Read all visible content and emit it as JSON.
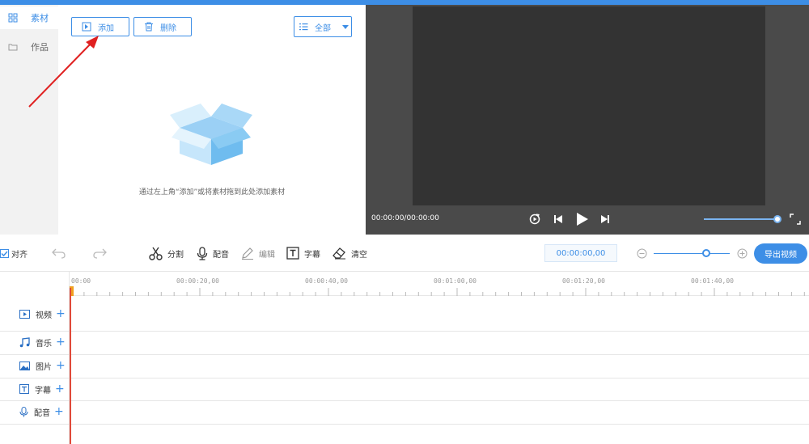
{
  "nav": {
    "items": [
      {
        "label": "素材",
        "icon": "grid-icon",
        "active": true
      },
      {
        "label": "作品",
        "icon": "folder-icon",
        "active": false
      }
    ]
  },
  "media": {
    "add_label": "添加",
    "delete_label": "删除",
    "filter_label": "全部",
    "empty_hint": "通过左上角“添加”或将素材拖到此处添加素材"
  },
  "preview": {
    "timecode": "00:00:00/00:00:00",
    "volume_level": 1.0
  },
  "toolbar": {
    "align_label": "对齐",
    "align_checked": true,
    "split_label": "分割",
    "dub_label": "配音",
    "edit_label": "编辑",
    "subtitle_label": "字幕",
    "clear_label": "清空",
    "time_value": "00:00:00,00",
    "zoom_level": 0.64,
    "export_label": "导出视频"
  },
  "timeline": {
    "ruler_labels": [
      "00:00",
      "00:00:20,00",
      "00:00:40,00",
      "00:01:00,00",
      "00:01:20,00",
      "00:01:40,00"
    ],
    "tracks": [
      {
        "label": "视频",
        "icon": "video-icon"
      },
      {
        "label": "音乐",
        "icon": "music-icon"
      },
      {
        "label": "图片",
        "icon": "image-icon"
      },
      {
        "label": "字幕",
        "icon": "text-icon"
      },
      {
        "label": "配音",
        "icon": "mic-icon"
      }
    ]
  },
  "colors": {
    "accent": "#3d8ee6",
    "playhead": "#e04a3a",
    "arrow": "#e02020"
  }
}
